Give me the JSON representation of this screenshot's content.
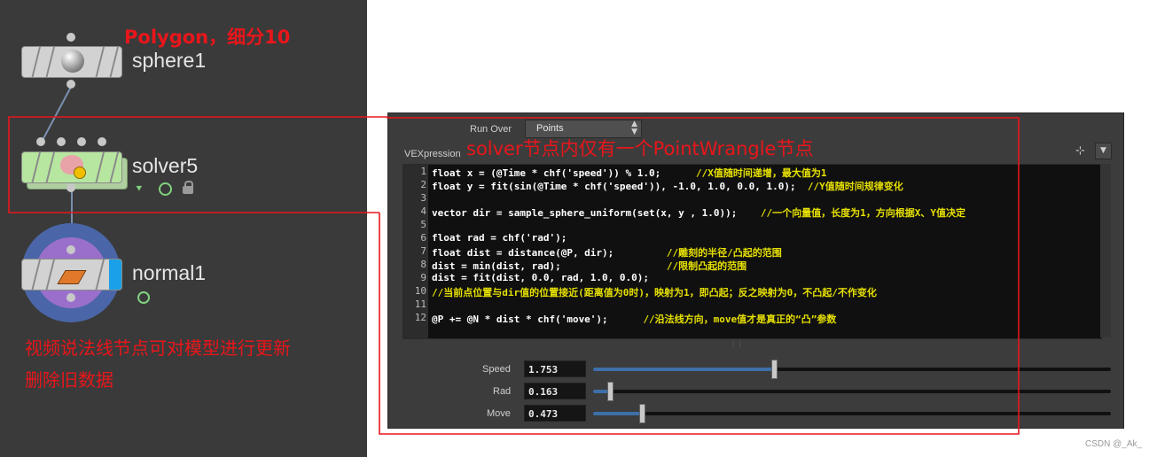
{
  "annotations": {
    "polygon_note": "Polygon，细分10",
    "solver_note": "solver节点内仅有一个PointWrangle节点",
    "bottom_note_line1": "视频说法线节点可对模型进行更新",
    "bottom_note_line2": "删除旧数据"
  },
  "nodes": [
    {
      "name": "sphere1",
      "icon": "sphere-icon"
    },
    {
      "name": "solver5",
      "icon": "brain-solver-icon"
    },
    {
      "name": "normal1",
      "icon": "normal-icon"
    }
  ],
  "parameters": {
    "run_over_label": "Run Over",
    "run_over_value": "Points",
    "vexpression_label": "VEXpression",
    "sliders": [
      {
        "label": "Speed",
        "value": "1.753",
        "fraction": 0.34
      },
      {
        "label": "Rad",
        "value": "0.163",
        "fraction": 0.03
      },
      {
        "label": "Move",
        "value": "0.473",
        "fraction": 0.09
      }
    ]
  },
  "code_lines": [
    "1",
    "2",
    "3",
    "4",
    "5",
    "6",
    "7",
    "8",
    "9",
    "10",
    "11",
    "12"
  ],
  "code": {
    "l1_code": "float x = (@Time * chf('speed')) % 1.0;",
    "l1_comment": "//X值随时间递增，最大值为1",
    "l2_code": "float y = fit(sin(@Time * chf('speed')), -1.0, 1.0, 0.0, 1.0);",
    "l2_comment": "//Y值随时间规律变化",
    "l4_code": "vector dir = sample_sphere_uniform(set(x, y , 1.0));",
    "l4_comment": "//一个向量值，长度为1，方向根据X、Y值决定",
    "l6_code": "float rad = chf('rad');",
    "l7_code": "float dist = distance(@P, dir);",
    "l7_comment": "//雕刻的半径/凸起的范围",
    "l8_code": "dist = min(dist, rad);",
    "l8_comment": "//限制凸起的范围",
    "l9_code": "dist = fit(dist, 0.0, rad, 1.0, 0.0);",
    "l10_comment": "//当前点位置与dir值的位置接近(距离值为0时)，映射为1，即凸起；反之映射为0，不凸起/不作变化",
    "l12_code": "@P += @N * dist * chf('move');",
    "l12_comment": "//沿法线方向，move值才是真正的“凸”参数"
  },
  "watermark": "CSDN @_Ak_",
  "colors": {
    "annotation_red": "#e8161b",
    "solver_green": "#b7e6a0",
    "normal_ring": "#4a66a8"
  }
}
